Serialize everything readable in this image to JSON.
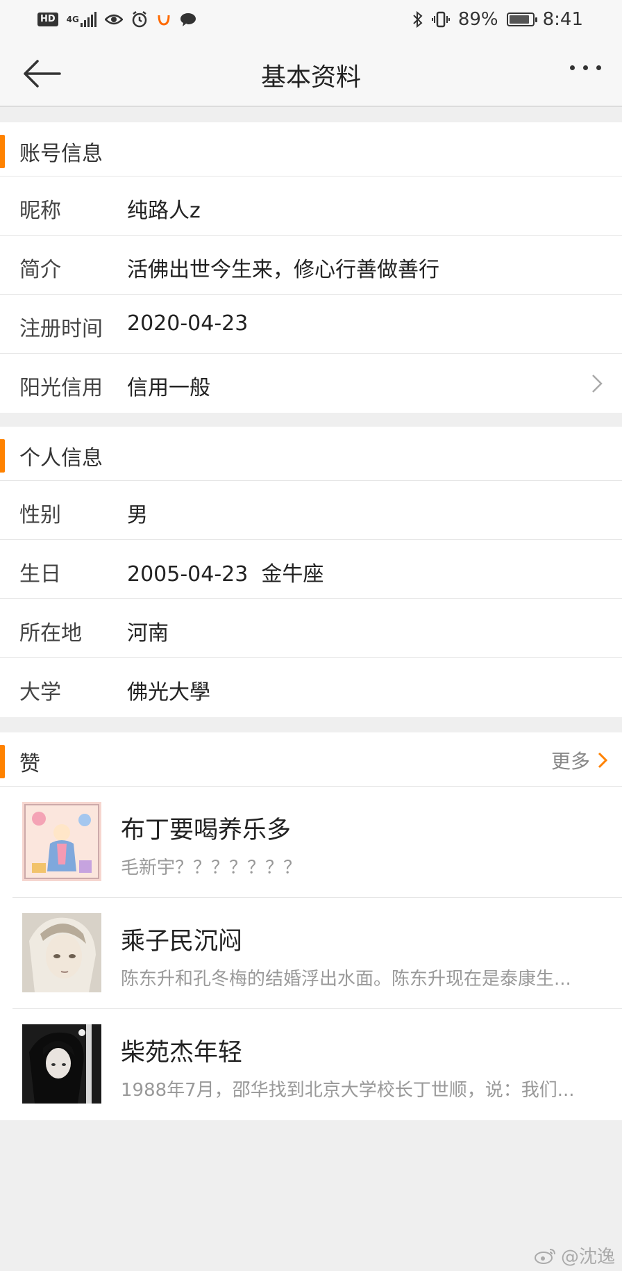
{
  "status_bar": {
    "left_icons": [
      "hd-icon",
      "4g-signal-icon",
      "eye-icon",
      "alarm-icon",
      "app-icon",
      "chat-icon"
    ],
    "network": "4G",
    "battery_percent": "89%",
    "battery_level": 0.89,
    "time": "8:41"
  },
  "nav": {
    "title": "基本资料",
    "back_icon": "arrow-left-icon",
    "more_icon": "more-dots-icon"
  },
  "account_section": {
    "title": "账号信息",
    "rows": [
      {
        "label": "昵称",
        "value": "纯路人z"
      },
      {
        "label": "简介",
        "value": "活佛出世今生来，修心行善做善行"
      },
      {
        "label": "注册时间",
        "value": "2020-04-23"
      },
      {
        "label": "阳光信用",
        "value": "信用一般"
      }
    ]
  },
  "personal_section": {
    "title": "个人信息",
    "rows": [
      {
        "label": "性别",
        "value": "男"
      },
      {
        "label": "生日",
        "value": "2005-04-23  金牛座"
      },
      {
        "label": "所在地",
        "value": "河南"
      },
      {
        "label": "大学",
        "value": "佛光大學"
      }
    ]
  },
  "likes_section": {
    "title": "赞",
    "more_label": "更多",
    "items": [
      {
        "title": "布丁要喝养乐多",
        "desc": "毛新宇？？？？？？？"
      },
      {
        "title": "乘子民沉闷",
        "desc": "陈东升和孔冬梅的结婚浮出水面。陈东升现在是泰康生..."
      },
      {
        "title": "柴苑杰年轻",
        "desc": "1988年7月，邵华找到北京大学校长丁世顺，说：我们..."
      }
    ]
  },
  "watermark": "@沈逸",
  "colors": {
    "accent": "#ff8200",
    "background": "#efefef",
    "card": "#ffffff"
  }
}
